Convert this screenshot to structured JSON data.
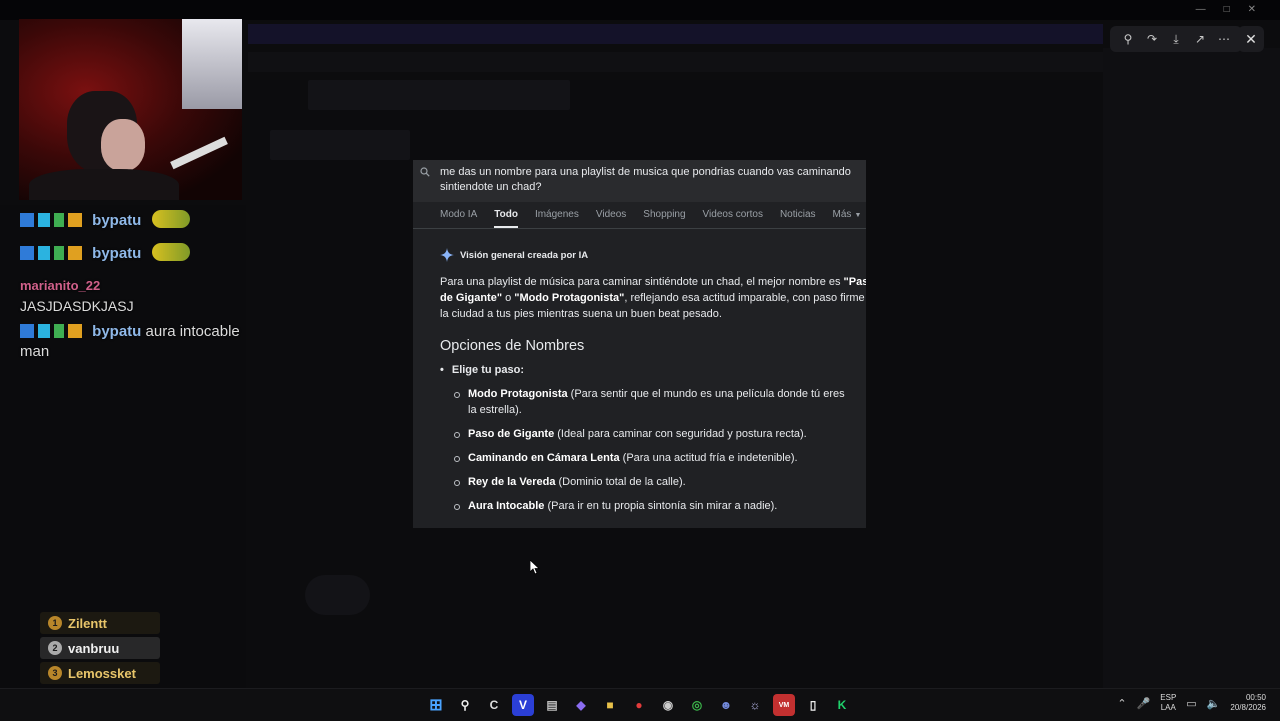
{
  "search": {
    "query": "me das un nombre para una playlist de musica que pondrias cuando vas caminando sintiendote un chad?",
    "tabs": [
      "Modo IA",
      "Todo",
      "Imágenes",
      "Videos",
      "Shopping",
      "Videos cortos",
      "Noticias",
      "Más"
    ],
    "active_tab": "Todo"
  },
  "ai_overview": {
    "heading": "Visión general creada por IA",
    "summary_parts": [
      "Para una playlist de música para caminar sintiéndote un chad, el mejor nombre es ",
      "\"Paso de Gigante\"",
      " o ",
      "\"Modo Protagonista\"",
      ", reflejando esa actitud imparable, con paso firme y la ciudad a tus pies mientras suena un buen beat pesado."
    ],
    "options_heading": "Opciones de Nombres",
    "bullet": "Elige tu paso:",
    "items": [
      {
        "name": "Modo Protagonista",
        "desc": " (Para sentir que el mundo es una película donde tú eres la estrella)."
      },
      {
        "name": "Paso de Gigante",
        "desc": " (Ideal para caminar con seguridad y postura recta)."
      },
      {
        "name": "Caminando en Cámara Lenta",
        "desc": " (Para una actitud fría e indetenible)."
      },
      {
        "name": "Rey de la Vereda",
        "desc": " (Dominio total de la calle)."
      },
      {
        "name": "Aura Intocable",
        "desc": " (Para ir en tu propia sintonía sin mirar a nadie)."
      }
    ]
  },
  "chat": [
    {
      "user": "bypatu",
      "msg": ""
    },
    {
      "user": "bypatu",
      "msg": ""
    },
    {
      "user": "marianito_22",
      "msg": "JASJDASDKJASJ"
    },
    {
      "user": "bypatu",
      "msg": "aura intocable man"
    }
  ],
  "leaderboard": [
    {
      "rank": "1",
      "name": "Zilentt"
    },
    {
      "rank": "2",
      "name": "vanbruu"
    },
    {
      "rank": "3",
      "name": "Lemossket"
    }
  ],
  "taskbar": {
    "lang_top": "ESP",
    "lang_bottom": "LAA",
    "time": "00:50",
    "date": "20/8/2026"
  }
}
